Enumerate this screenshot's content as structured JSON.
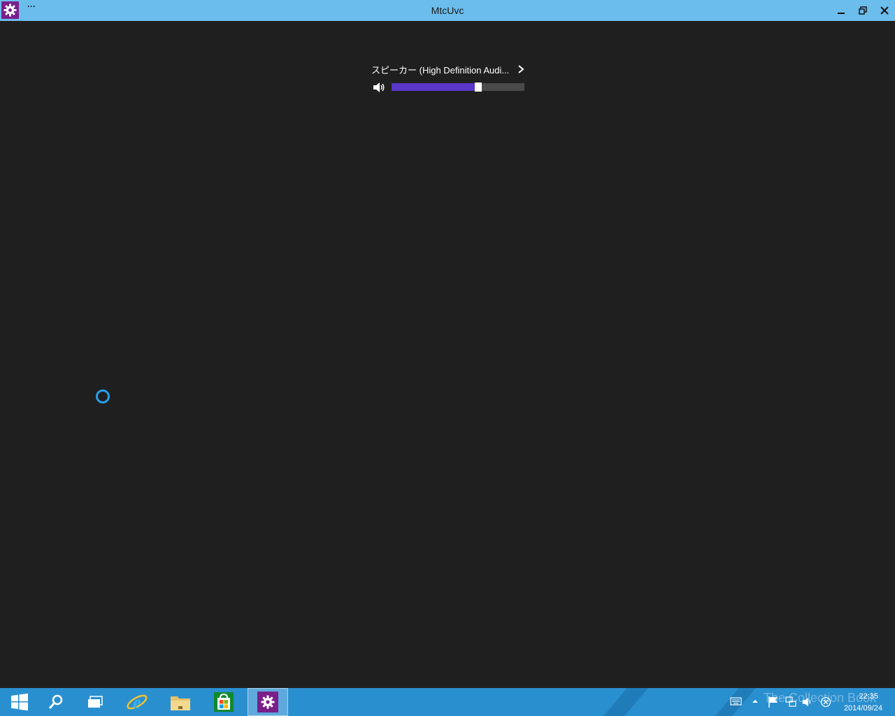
{
  "window": {
    "title": "MtcUvc",
    "more_label": "···"
  },
  "volume": {
    "device_label": "スピーカー (High Definition Audi...",
    "level_percent": 65,
    "accent_color": "#5a36c9"
  },
  "taskbar": {
    "items": [
      {
        "name": "start",
        "icon": "windows-logo-icon"
      },
      {
        "name": "search",
        "icon": "search-icon"
      },
      {
        "name": "task-view",
        "icon": "task-view-icon"
      },
      {
        "name": "internet-explorer",
        "icon": "ie-icon"
      },
      {
        "name": "file-explorer",
        "icon": "folder-icon"
      },
      {
        "name": "store",
        "icon": "store-icon"
      },
      {
        "name": "settings",
        "icon": "gear-icon",
        "active": true
      }
    ],
    "watermark": "The Collection Book",
    "clock_time": "22:35",
    "clock_date": "2014/09/24"
  }
}
